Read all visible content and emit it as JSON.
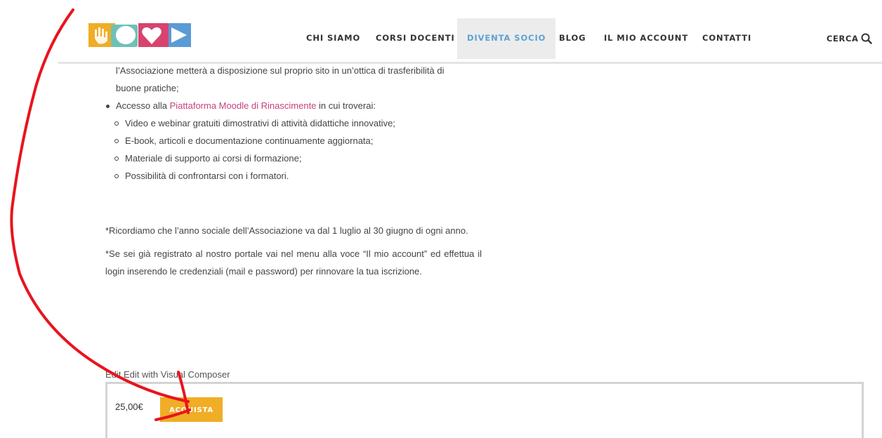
{
  "header": {
    "nav": [
      {
        "label": "CHI SIAMO"
      },
      {
        "label": "CORSI DOCENTI"
      },
      {
        "label": "DIVENTA SOCIO",
        "active": true
      },
      {
        "label": "BLOG"
      },
      {
        "label": "IL MIO ACCOUNT"
      },
      {
        "label": "CONTATTI"
      }
    ],
    "search_label": "CERCA",
    "search_icon": "search-icon",
    "logo_colors": [
      "#f0ad26",
      "#6ec1b5",
      "#d8446e",
      "#5b9bd5"
    ]
  },
  "content": {
    "intro_line1": "l’Associazione metterà a disposizione sul  proprio sito in un’ottica di trasferibilità di",
    "intro_line2": "buone pratiche;",
    "bullet_prefix": "Accesso alla ",
    "bullet_link": "Piattaforma Moodle di Rinascimente",
    "bullet_suffix": " in cui troverai:",
    "sub_items": [
      "Video e webinar gratuiti dimostrativi di attività didattiche innovative;",
      "E-book, articoli e documentazione continuamente aggiornata;",
      "Materiale di supporto ai corsi di formazione;",
      "Possibilità di confrontarsi con i formatori."
    ],
    "note1": "*Ricordiamo che l’anno sociale dell’Associazione va dal 1 luglio al 30 giugno di ogni anno.",
    "note2": "*Se sei già registrato al nostro portale vai nel menu alla voce “Il mio account” ed effettua il login inserendo le credenziali (mail e password) per rinnovare la tua iscrizione."
  },
  "product": {
    "edit_label": "Edit Edit with Visual Composer",
    "price": "25,00€",
    "buy_label": "ACQUISTA"
  },
  "colors": {
    "accent_link": "#c8407e",
    "nav_active": "#5ba3d4",
    "buy_button": "#f0ad26",
    "annotation": "#e8141e"
  }
}
